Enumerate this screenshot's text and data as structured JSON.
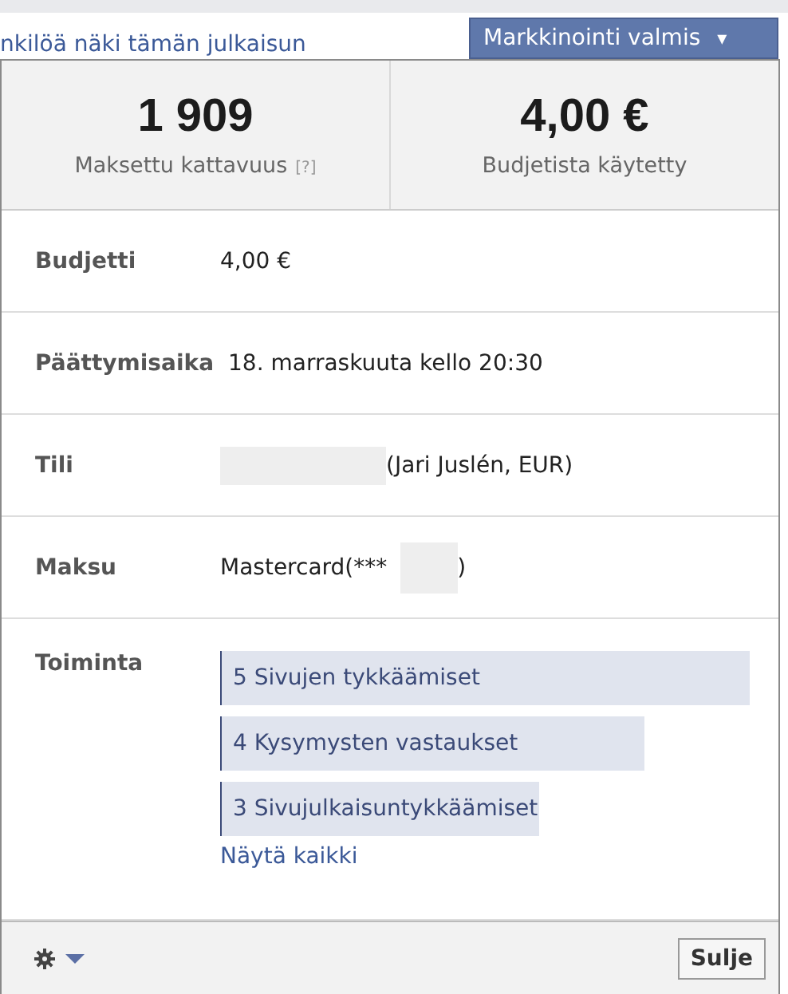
{
  "top_link": "nkilöä näki tämän julkaisun",
  "status_button": {
    "label": "Markkinointi valmis",
    "caret": "▾"
  },
  "stats": [
    {
      "value": "1 909",
      "label": "Maksettu kattavuus",
      "help": "[?]"
    },
    {
      "value": "4,00 €",
      "label": "Budjetista käytetty"
    }
  ],
  "details": [
    {
      "label": "Budjetti",
      "parts": [
        {
          "kind": "text",
          "text": "4,00 €"
        }
      ]
    },
    {
      "label": "Päättymisaika",
      "parts": [
        {
          "kind": "text",
          "text": "18. marraskuuta kello 20:30"
        }
      ]
    },
    {
      "label": "Tili",
      "parts": [
        {
          "kind": "redacted"
        },
        {
          "kind": "text",
          "text": "(Jari Juslén, EUR)"
        }
      ]
    },
    {
      "label": "Maksu",
      "parts": [
        {
          "kind": "text",
          "text": "Mastercard(***"
        },
        {
          "kind": "redacted"
        },
        {
          "kind": "text",
          "text": ")"
        }
      ]
    }
  ],
  "actions": {
    "label": "Toiminta",
    "items": [
      {
        "text": "5 Sivujen tykkäämiset"
      },
      {
        "text": "4 Kysymysten vastaukset"
      },
      {
        "text": "3 Sivujulkaisuntykkäämiset"
      }
    ],
    "show_all": "Näytä kaikki"
  },
  "footer": {
    "close": "Sulje"
  }
}
